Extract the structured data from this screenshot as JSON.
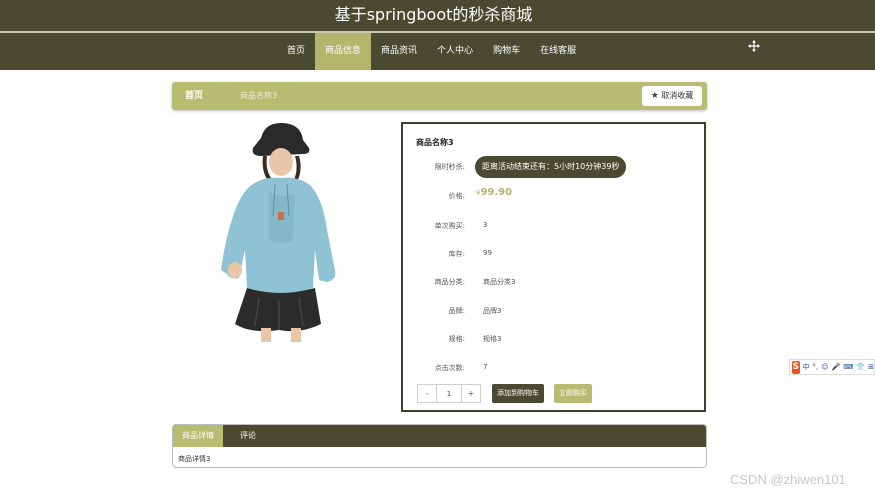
{
  "site": {
    "title": "基于springboot的秒杀商城"
  },
  "nav": {
    "items": [
      {
        "label": "首页"
      },
      {
        "label": "商品信息"
      },
      {
        "label": "商品资讯"
      },
      {
        "label": "个人中心"
      },
      {
        "label": "购物车"
      },
      {
        "label": "在线客服"
      }
    ],
    "active": "商品信息"
  },
  "breadcrumb": {
    "home": "首页",
    "current": "商品名称3"
  },
  "favorite_button": {
    "label": "取消收藏",
    "icon": "star-icon"
  },
  "product": {
    "name": "商品名称3",
    "flash_label": "限时秒杀:",
    "countdown": "距离活动结束还有：5小时10分钟39秒",
    "price_label": "价格:",
    "currency": "¥",
    "price": "99.90",
    "limit_label": "单次购买:",
    "limit": "3",
    "stock_label": "库存:",
    "stock": "99",
    "category_label": "商品分类:",
    "category": "商品分类3",
    "brand_label": "品牌:",
    "brand": "品牌3",
    "spec_label": "规格:",
    "spec": "规格3",
    "clicks_label": "点击次数:",
    "clicks": "7"
  },
  "quantity": {
    "minus": "-",
    "value": "1",
    "plus": "+"
  },
  "actions": {
    "add_to_cart": "添加到购物车",
    "buy_now": "立即购买"
  },
  "ime_toolbar": {
    "logo": "S",
    "segments": [
      "中",
      "°,",
      "☺",
      "🎤",
      "⌨",
      "👕",
      "⊞"
    ]
  },
  "tabs": {
    "items": [
      {
        "label": "商品详情"
      },
      {
        "label": "评论"
      }
    ],
    "active": "商品详情"
  },
  "detail": {
    "content": "商品详情3"
  },
  "watermark": "CSDN @zhiwen101",
  "colors": {
    "dark": "#4a4a33",
    "accent": "#b8bb72",
    "nav_active": "#b5b56b",
    "price": "#b5b56b"
  }
}
